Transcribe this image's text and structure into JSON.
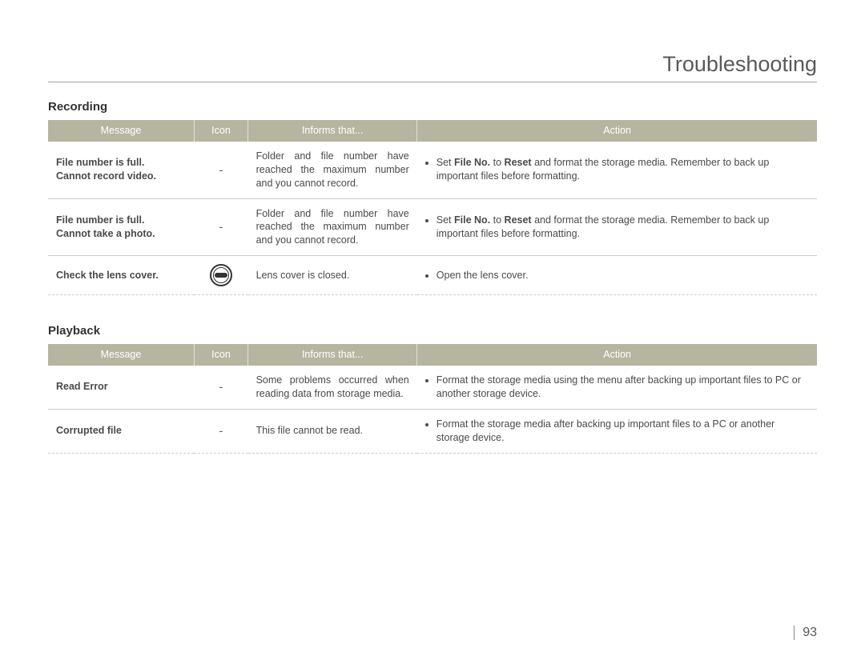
{
  "page": {
    "title": "Troubleshooting",
    "number": "93"
  },
  "sections": [
    {
      "heading": "Recording",
      "headers": {
        "message": "Message",
        "icon": "Icon",
        "informs": "Informs that...",
        "action": "Action"
      },
      "rows": [
        {
          "message_lines": [
            "File number is full.",
            "Cannot record video."
          ],
          "icon_text": "-",
          "icon_type": "dash",
          "informs": "Folder and file number have reached the maximum number and you cannot record.",
          "actions": [
            "Set <b>File No.</b> to <b>Reset</b> and format the storage media. Remember to back up important files before formatting."
          ]
        },
        {
          "message_lines": [
            "File number is full.",
            "Cannot take a photo."
          ],
          "icon_text": "-",
          "icon_type": "dash",
          "informs": "Folder and file number have reached the maximum number and you cannot record.",
          "actions": [
            "Set <b>File No.</b> to <b>Reset</b> and format the storage media. Remember to back up important files before formatting."
          ]
        },
        {
          "message_lines": [
            "Check the lens cover."
          ],
          "icon_text": "",
          "icon_type": "lens",
          "informs": "Lens cover is closed.",
          "actions": [
            "Open the lens cover."
          ]
        }
      ]
    },
    {
      "heading": "Playback",
      "headers": {
        "message": "Message",
        "icon": "Icon",
        "informs": "Informs that...",
        "action": "Action"
      },
      "rows": [
        {
          "message_lines": [
            "Read Error"
          ],
          "icon_text": "-",
          "icon_type": "dash",
          "informs": "Some problems occurred when reading data from storage media.",
          "actions": [
            "Format the storage media using the menu after backing up important files to PC or another storage device."
          ]
        },
        {
          "message_lines": [
            "Corrupted file"
          ],
          "icon_text": "-",
          "icon_type": "dash",
          "informs": "This file cannot be read.",
          "actions": [
            "Format the storage media after backing up important files to a PC or another storage device."
          ]
        }
      ]
    }
  ]
}
